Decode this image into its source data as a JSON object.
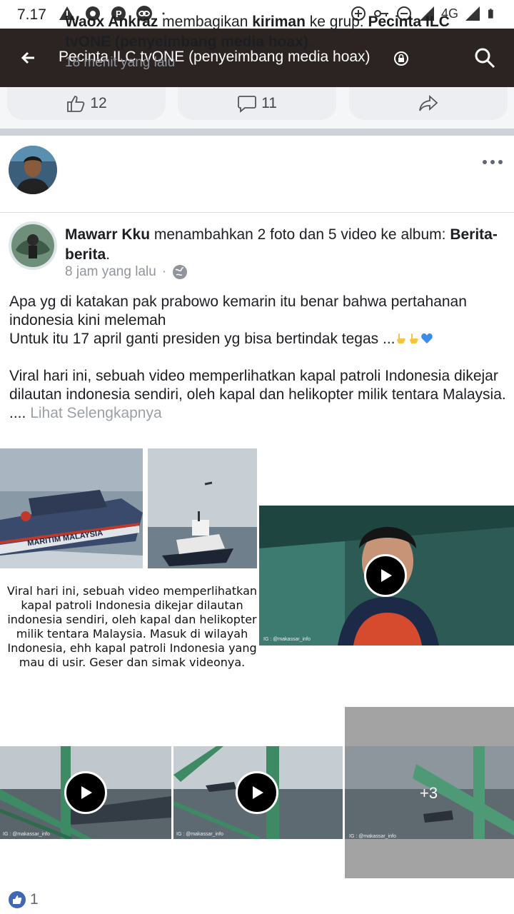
{
  "status_bar": {
    "time": "7.17",
    "network": "4G",
    "icons_left": [
      "warning-icon",
      "camera-shutter-icon",
      "parking-icon",
      "link-icon",
      "dot-icon"
    ],
    "icons_right": [
      "data-saver-icon",
      "vpn-key-icon",
      "do-not-disturb-icon",
      "signal-icon",
      "signal-icon",
      "battery-icon"
    ]
  },
  "app_bar": {
    "title": "Pecinta ILC tvONE (penyeimbang media hoax)",
    "background": "#2b2422"
  },
  "prev_post_actions": {
    "like_count": "12",
    "comment_count": "11"
  },
  "share_post": {
    "author": "Waox Ankraz",
    "verb": " membagikan ",
    "object": "kiriman",
    "connector": " ke grup: ",
    "group": "Pecinta ILC tvONE (penyeimbang media hoax)",
    "end": ".",
    "time": "18 menit yang lalu"
  },
  "album_post": {
    "author": "Mawarr Kku",
    "verb": " menambahkan 2 foto dan 5 video ke album: ",
    "album": "Berita-berita",
    "end": ".",
    "time": "8 jam yang lalu",
    "separator": "·",
    "body_line1": "Apa yg di katakan pak prabowo kemarin itu benar bahwa pertahanan indonesia kini melemah",
    "body_line2": "Untuk itu 17 april ganti presiden yg bisa bertindak tegas ...",
    "body_para2": "Viral hari ini, sebuah video memperlihatkan kapal patroli Indonesia dikejar dilautan indonesia sendiri, oleh kapal dan helikopter milik tentara Malaysia.",
    "ellipsis": "....",
    "see_more": "Lihat Selengkapnya"
  },
  "media": {
    "ship_label": "MARITIM MALAYSIA",
    "caption": "Viral hari ini, sebuah video memperlihatkan kapal patroli Indonesia dikejar dilautan indonesia sendiri, oleh kapal dan helikopter milik tentara Malaysia. Masuk di wilayah Indonesia, ehh kapal patroli Indonesia yang mau di usir. Geser dan simak videonya.",
    "watermark": "IG : @makassar_info",
    "more_count": "+3"
  },
  "reactions": {
    "count": "1"
  },
  "colors": {
    "facebook_blue": "#4267b2",
    "meta_gray": "#90949c"
  }
}
